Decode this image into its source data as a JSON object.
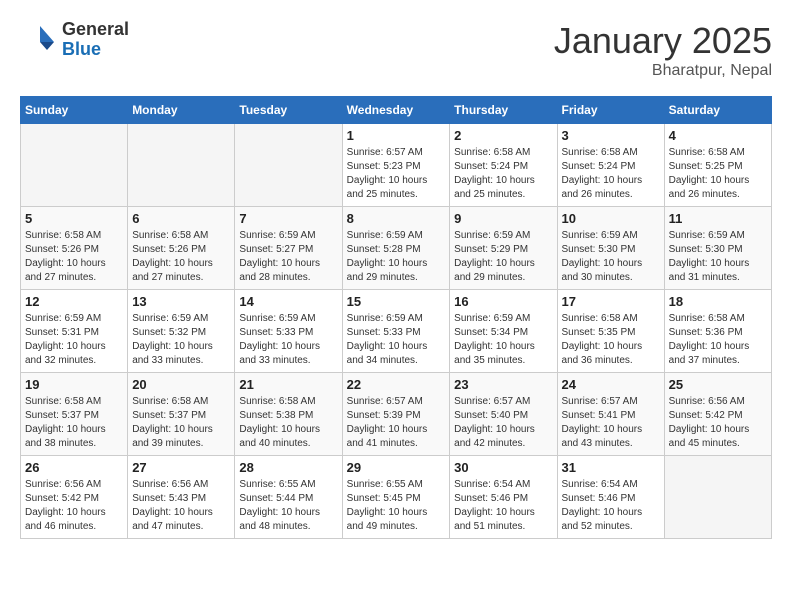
{
  "header": {
    "logo_general": "General",
    "logo_blue": "Blue",
    "title": "January 2025",
    "subtitle": "Bharatpur, Nepal"
  },
  "weekdays": [
    "Sunday",
    "Monday",
    "Tuesday",
    "Wednesday",
    "Thursday",
    "Friday",
    "Saturday"
  ],
  "weeks": [
    [
      {
        "day": "",
        "sunrise": "",
        "sunset": "",
        "daylight": ""
      },
      {
        "day": "",
        "sunrise": "",
        "sunset": "",
        "daylight": ""
      },
      {
        "day": "",
        "sunrise": "",
        "sunset": "",
        "daylight": ""
      },
      {
        "day": "1",
        "sunrise": "Sunrise: 6:57 AM",
        "sunset": "Sunset: 5:23 PM",
        "daylight": "Daylight: 10 hours and 25 minutes."
      },
      {
        "day": "2",
        "sunrise": "Sunrise: 6:58 AM",
        "sunset": "Sunset: 5:24 PM",
        "daylight": "Daylight: 10 hours and 25 minutes."
      },
      {
        "day": "3",
        "sunrise": "Sunrise: 6:58 AM",
        "sunset": "Sunset: 5:24 PM",
        "daylight": "Daylight: 10 hours and 26 minutes."
      },
      {
        "day": "4",
        "sunrise": "Sunrise: 6:58 AM",
        "sunset": "Sunset: 5:25 PM",
        "daylight": "Daylight: 10 hours and 26 minutes."
      }
    ],
    [
      {
        "day": "5",
        "sunrise": "Sunrise: 6:58 AM",
        "sunset": "Sunset: 5:26 PM",
        "daylight": "Daylight: 10 hours and 27 minutes."
      },
      {
        "day": "6",
        "sunrise": "Sunrise: 6:58 AM",
        "sunset": "Sunset: 5:26 PM",
        "daylight": "Daylight: 10 hours and 27 minutes."
      },
      {
        "day": "7",
        "sunrise": "Sunrise: 6:59 AM",
        "sunset": "Sunset: 5:27 PM",
        "daylight": "Daylight: 10 hours and 28 minutes."
      },
      {
        "day": "8",
        "sunrise": "Sunrise: 6:59 AM",
        "sunset": "Sunset: 5:28 PM",
        "daylight": "Daylight: 10 hours and 29 minutes."
      },
      {
        "day": "9",
        "sunrise": "Sunrise: 6:59 AM",
        "sunset": "Sunset: 5:29 PM",
        "daylight": "Daylight: 10 hours and 29 minutes."
      },
      {
        "day": "10",
        "sunrise": "Sunrise: 6:59 AM",
        "sunset": "Sunset: 5:30 PM",
        "daylight": "Daylight: 10 hours and 30 minutes."
      },
      {
        "day": "11",
        "sunrise": "Sunrise: 6:59 AM",
        "sunset": "Sunset: 5:30 PM",
        "daylight": "Daylight: 10 hours and 31 minutes."
      }
    ],
    [
      {
        "day": "12",
        "sunrise": "Sunrise: 6:59 AM",
        "sunset": "Sunset: 5:31 PM",
        "daylight": "Daylight: 10 hours and 32 minutes."
      },
      {
        "day": "13",
        "sunrise": "Sunrise: 6:59 AM",
        "sunset": "Sunset: 5:32 PM",
        "daylight": "Daylight: 10 hours and 33 minutes."
      },
      {
        "day": "14",
        "sunrise": "Sunrise: 6:59 AM",
        "sunset": "Sunset: 5:33 PM",
        "daylight": "Daylight: 10 hours and 33 minutes."
      },
      {
        "day": "15",
        "sunrise": "Sunrise: 6:59 AM",
        "sunset": "Sunset: 5:33 PM",
        "daylight": "Daylight: 10 hours and 34 minutes."
      },
      {
        "day": "16",
        "sunrise": "Sunrise: 6:59 AM",
        "sunset": "Sunset: 5:34 PM",
        "daylight": "Daylight: 10 hours and 35 minutes."
      },
      {
        "day": "17",
        "sunrise": "Sunrise: 6:58 AM",
        "sunset": "Sunset: 5:35 PM",
        "daylight": "Daylight: 10 hours and 36 minutes."
      },
      {
        "day": "18",
        "sunrise": "Sunrise: 6:58 AM",
        "sunset": "Sunset: 5:36 PM",
        "daylight": "Daylight: 10 hours and 37 minutes."
      }
    ],
    [
      {
        "day": "19",
        "sunrise": "Sunrise: 6:58 AM",
        "sunset": "Sunset: 5:37 PM",
        "daylight": "Daylight: 10 hours and 38 minutes."
      },
      {
        "day": "20",
        "sunrise": "Sunrise: 6:58 AM",
        "sunset": "Sunset: 5:37 PM",
        "daylight": "Daylight: 10 hours and 39 minutes."
      },
      {
        "day": "21",
        "sunrise": "Sunrise: 6:58 AM",
        "sunset": "Sunset: 5:38 PM",
        "daylight": "Daylight: 10 hours and 40 minutes."
      },
      {
        "day": "22",
        "sunrise": "Sunrise: 6:57 AM",
        "sunset": "Sunset: 5:39 PM",
        "daylight": "Daylight: 10 hours and 41 minutes."
      },
      {
        "day": "23",
        "sunrise": "Sunrise: 6:57 AM",
        "sunset": "Sunset: 5:40 PM",
        "daylight": "Daylight: 10 hours and 42 minutes."
      },
      {
        "day": "24",
        "sunrise": "Sunrise: 6:57 AM",
        "sunset": "Sunset: 5:41 PM",
        "daylight": "Daylight: 10 hours and 43 minutes."
      },
      {
        "day": "25",
        "sunrise": "Sunrise: 6:56 AM",
        "sunset": "Sunset: 5:42 PM",
        "daylight": "Daylight: 10 hours and 45 minutes."
      }
    ],
    [
      {
        "day": "26",
        "sunrise": "Sunrise: 6:56 AM",
        "sunset": "Sunset: 5:42 PM",
        "daylight": "Daylight: 10 hours and 46 minutes."
      },
      {
        "day": "27",
        "sunrise": "Sunrise: 6:56 AM",
        "sunset": "Sunset: 5:43 PM",
        "daylight": "Daylight: 10 hours and 47 minutes."
      },
      {
        "day": "28",
        "sunrise": "Sunrise: 6:55 AM",
        "sunset": "Sunset: 5:44 PM",
        "daylight": "Daylight: 10 hours and 48 minutes."
      },
      {
        "day": "29",
        "sunrise": "Sunrise: 6:55 AM",
        "sunset": "Sunset: 5:45 PM",
        "daylight": "Daylight: 10 hours and 49 minutes."
      },
      {
        "day": "30",
        "sunrise": "Sunrise: 6:54 AM",
        "sunset": "Sunset: 5:46 PM",
        "daylight": "Daylight: 10 hours and 51 minutes."
      },
      {
        "day": "31",
        "sunrise": "Sunrise: 6:54 AM",
        "sunset": "Sunset: 5:46 PM",
        "daylight": "Daylight: 10 hours and 52 minutes."
      },
      {
        "day": "",
        "sunrise": "",
        "sunset": "",
        "daylight": ""
      }
    ]
  ]
}
